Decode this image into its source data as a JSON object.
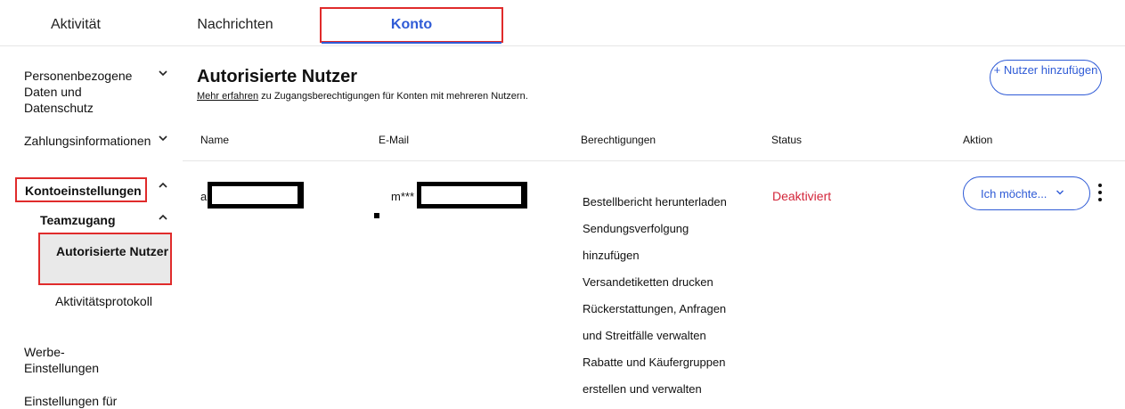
{
  "tabs": [
    {
      "label": "Aktivität"
    },
    {
      "label": "Nachrichten"
    },
    {
      "label": "Konto"
    }
  ],
  "sidebar": {
    "items": [
      {
        "label": "Personenbezogene Daten und Datenschutz"
      },
      {
        "label": "Zahlungsinformationen"
      },
      {
        "label": "Kontoeinstellungen"
      },
      {
        "label": "Teamzugang"
      },
      {
        "label": "Autorisierte Nutzer"
      },
      {
        "label": "Aktivitätsprotokoll"
      },
      {
        "label": "Werbe-Einstellungen"
      },
      {
        "label": "Einstellungen für"
      }
    ]
  },
  "main": {
    "title": "Autorisierte Nutzer",
    "subtitle_link": "Mehr erfahren",
    "subtitle_rest": " zu Zugangsberechtigungen für Konten mit mehreren Nutzern.",
    "add_button": "+ Nutzer hinzufügen"
  },
  "table": {
    "headers": [
      "Name",
      "E-Mail",
      "Berechtigungen",
      "Status",
      "Aktion"
    ],
    "rows": [
      {
        "name_prefix": "a",
        "email_prefix": "m***",
        "permissions": [
          "Bestellbericht herunterladen",
          "Sendungsverfolgung",
          "hinzufügen",
          "Versandetiketten drucken",
          "Rückerstattungen, Anfragen",
          "und Streitfälle verwalten",
          "Rabatte und Käufergruppen",
          "erstellen und verwalten"
        ],
        "status": "Deaktiviert",
        "action_label": "Ich möchte..."
      }
    ]
  },
  "colors": {
    "accent": "#2f5bd6",
    "status_deactivated": "#d3263a",
    "highlight_box": "#e02b2b",
    "selected_bg": "#e9e9e9"
  }
}
